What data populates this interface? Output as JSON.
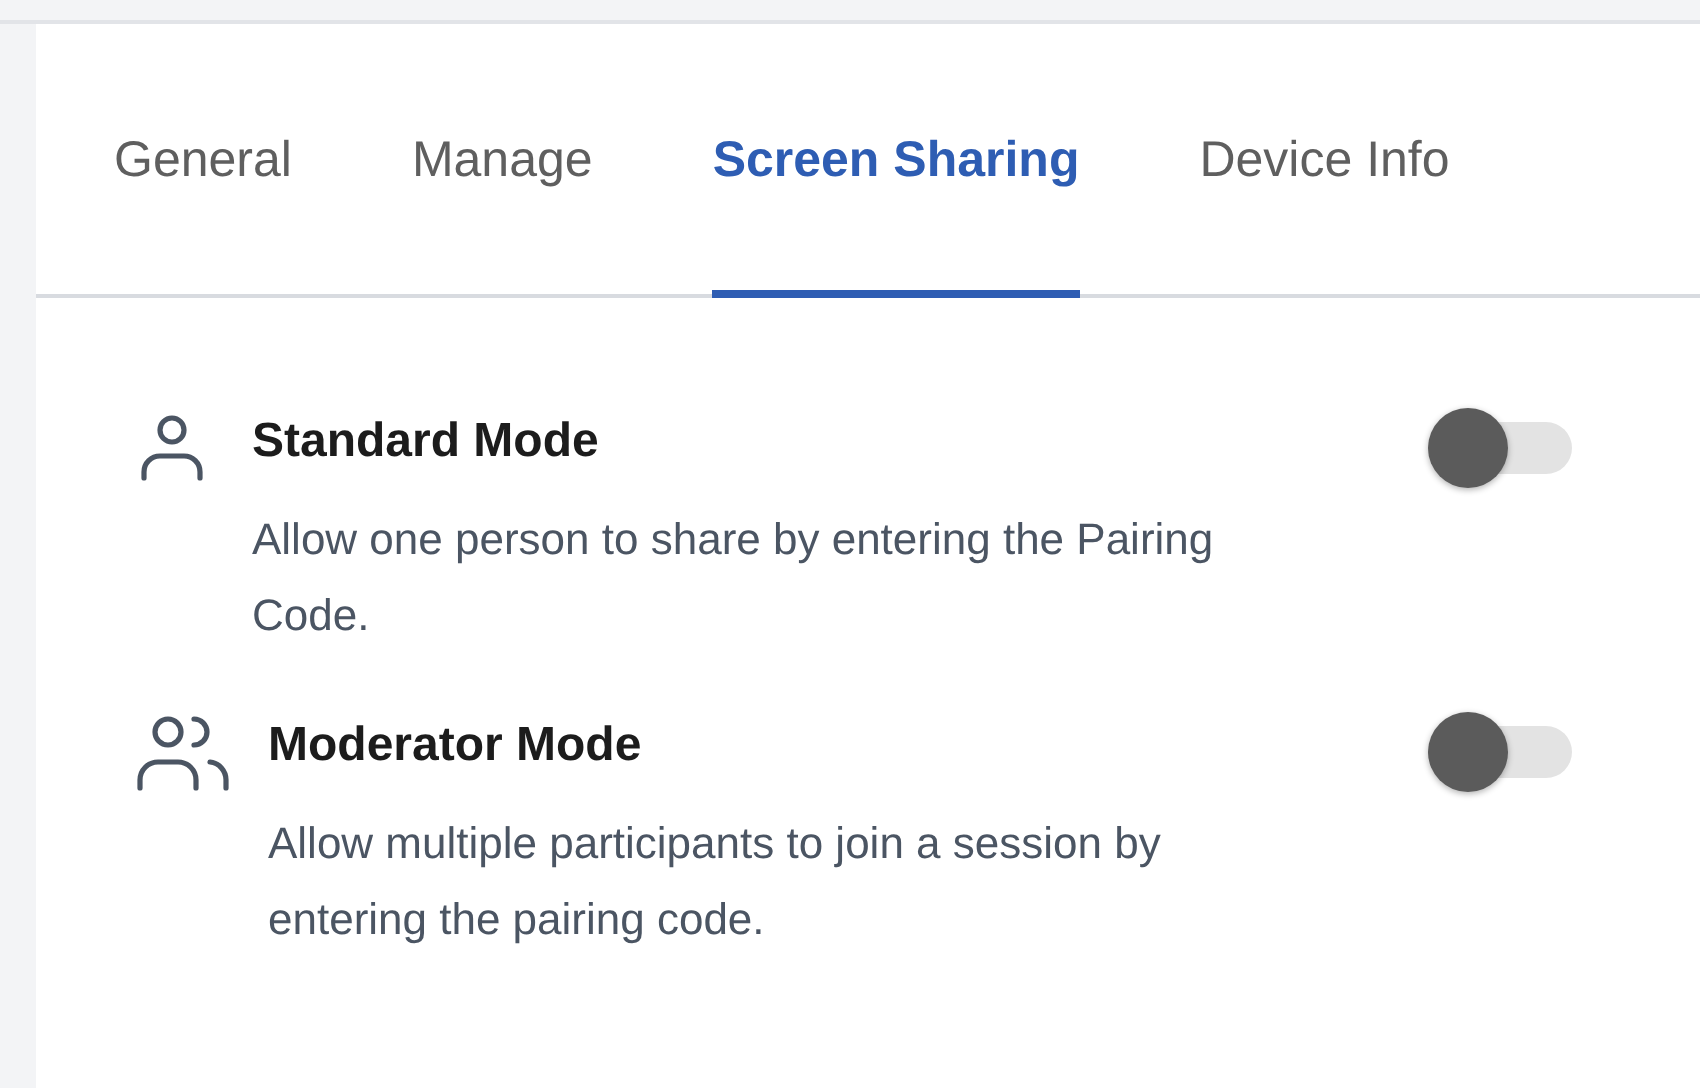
{
  "tabs": [
    {
      "label": "General",
      "selected": false
    },
    {
      "label": "Manage",
      "selected": false
    },
    {
      "label": "Screen Sharing",
      "selected": true
    },
    {
      "label": "Device Info",
      "selected": false
    }
  ],
  "modes": [
    {
      "kind": "single",
      "title": "Standard Mode",
      "description": "Allow one person to share by entering the Pairing Code.",
      "on": false
    },
    {
      "kind": "group",
      "title": "Moderator Mode",
      "description": "Allow multiple participants to join a session by entering the pairing code.",
      "on": false
    }
  ]
}
